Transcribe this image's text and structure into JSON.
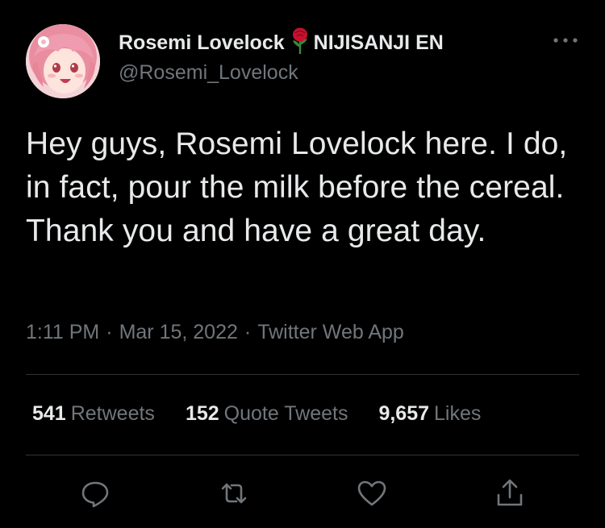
{
  "author": {
    "display_name": "Rosemi Lovelock",
    "emoji_icon": "rose-icon",
    "affiliation": "NIJISANJI EN",
    "handle": "@Rosemi_Lovelock",
    "avatar": "avatar-pink-hair-anime-girl"
  },
  "menu": {
    "icon": "more-horizontal-icon"
  },
  "tweet": {
    "text": "Hey guys, Rosemi Lovelock here. I do, in fact, pour the milk before the cereal. Thank you and have a great day."
  },
  "meta": {
    "time": "1:11 PM",
    "separator": "·",
    "date": "Mar 15, 2022",
    "source": "Twitter Web App"
  },
  "stats": {
    "retweets": {
      "count": "541",
      "label": "Retweets"
    },
    "quotes": {
      "count": "152",
      "label": "Quote Tweets"
    },
    "likes": {
      "count": "9,657",
      "label": "Likes"
    }
  },
  "actions": [
    {
      "name": "reply",
      "icon": "reply-icon"
    },
    {
      "name": "retweet",
      "icon": "retweet-icon"
    },
    {
      "name": "like",
      "icon": "heart-icon"
    },
    {
      "name": "share",
      "icon": "share-icon"
    }
  ],
  "colors": {
    "background": "#000000",
    "primary_text": "#e7e9ea",
    "secondary_text": "#71767b",
    "divider": "#2f3336",
    "rose": "#c8102e"
  }
}
